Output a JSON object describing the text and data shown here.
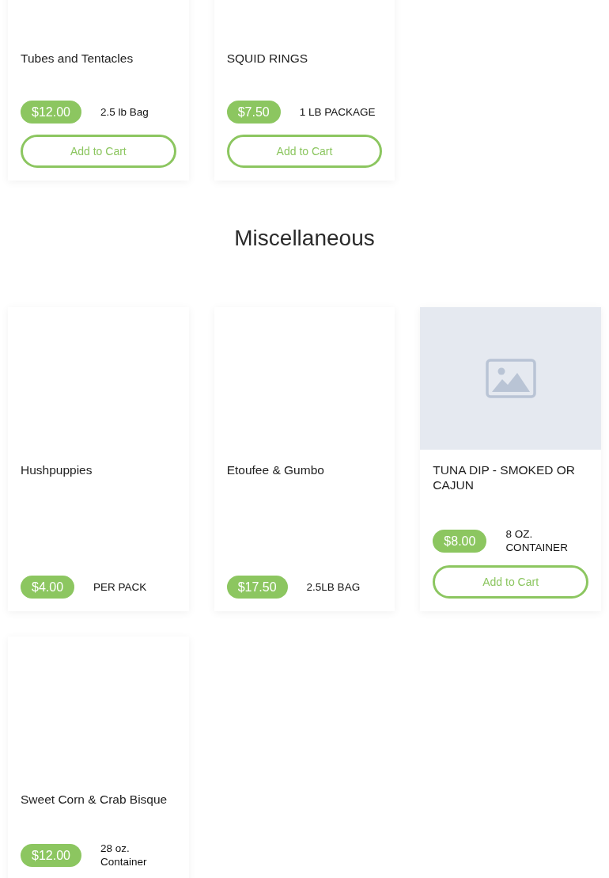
{
  "sections": [
    {
      "products": [
        {
          "title": "Tubes and Tentacles",
          "image_placeholder": false,
          "price": "$12.00",
          "unit": "2.5 lb Bag",
          "button": "Add to Cart"
        },
        {
          "title": "SQUID RINGS",
          "image_placeholder": false,
          "price": "$7.50",
          "unit": "1 LB PACKAGE",
          "button": "Add to Cart"
        }
      ]
    },
    {
      "heading": "Miscellaneous",
      "products": [
        {
          "title": "Hushpuppies",
          "image_placeholder": false,
          "price": "$4.00",
          "unit": "PER PACK"
        },
        {
          "title": "Etoufee & Gumbo",
          "image_placeholder": false,
          "price": "$17.50",
          "unit": "2.5LB BAG"
        },
        {
          "title": "TUNA DIP - SMOKED OR CAJUN",
          "image_placeholder": true,
          "price": "$8.00",
          "unit": "8 OZ. CONTAINER",
          "button": "Add to Cart"
        },
        {
          "title": "Sweet Corn & Crab Bisque",
          "image_placeholder": false,
          "price": "$12.00",
          "unit": "28 oz. Container"
        }
      ]
    }
  ]
}
